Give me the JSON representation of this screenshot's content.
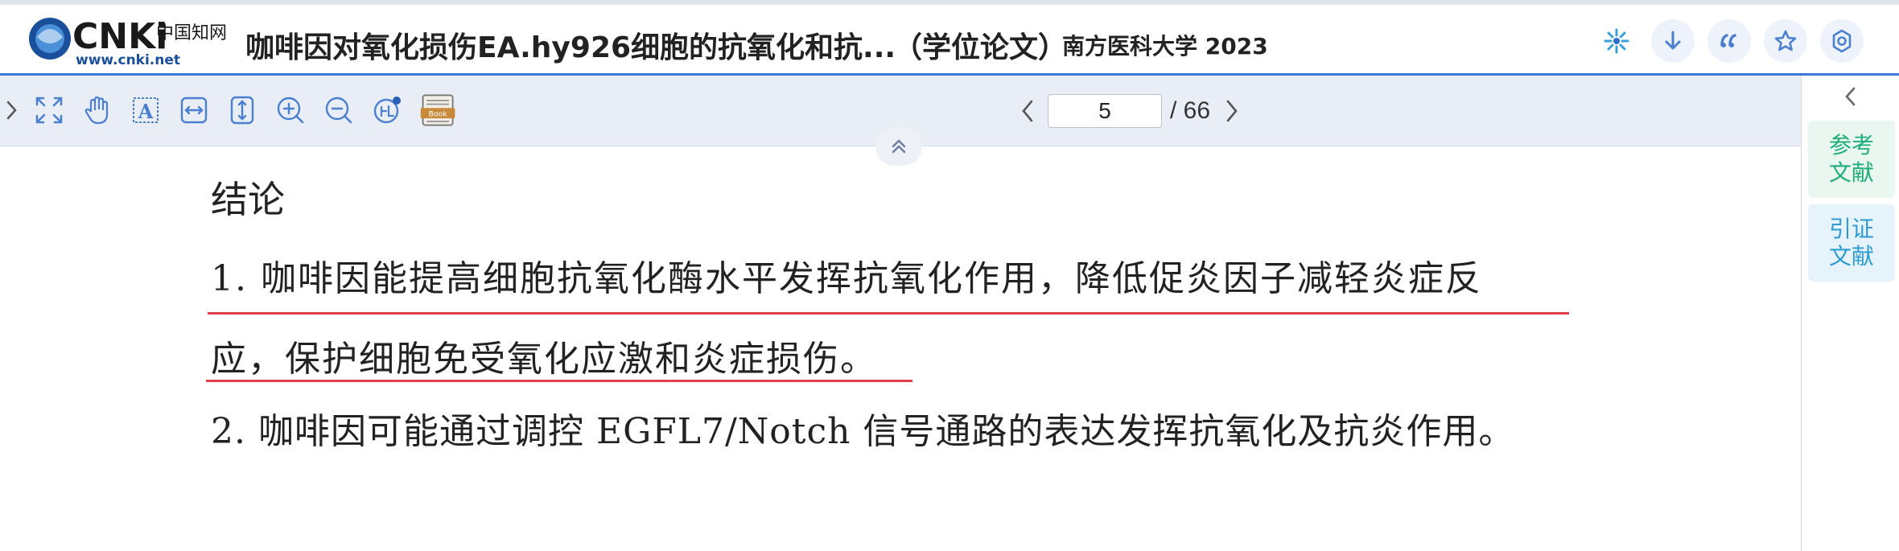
{
  "header": {
    "logo_main": "CNKi",
    "logo_cn": "中国知网",
    "logo_url": "www.cnki.net",
    "doc_title": "咖啡因对氧化损伤EA.hy926细胞的抗氧化和抗...",
    "doc_type": "（学位论文）",
    "doc_source": "南方医科大学 2023",
    "buttons": [
      {
        "name": "ai-assistant-icon"
      },
      {
        "name": "download-icon"
      },
      {
        "name": "quote-icon"
      },
      {
        "name": "favorite-star-icon"
      },
      {
        "name": "settings-gear-icon"
      }
    ]
  },
  "toolbar": {
    "tools": [
      "expand",
      "expand-fullscreen",
      "hand-pan",
      "text-select",
      "fit-width",
      "fit-height",
      "zoom-in",
      "zoom-out",
      "ocr",
      "book-view"
    ],
    "book_label": "Book",
    "page_current": "5",
    "page_total": "/ 66"
  },
  "side_panel": {
    "ref_label": "参考文献",
    "cite_label": "引证文献"
  },
  "content": {
    "heading": "结论",
    "line1": "1.  咖啡因能提高细胞抗氧化酶水平发挥抗氧化作用，降低促炎因子减轻炎症反",
    "line2": "应，保护细胞免受氧化应激和炎症损伤。",
    "line3": "2.  咖啡因可能通过调控 EGFL7/Notch 信号通路的表达发挥抗氧化及抗炎作用。"
  },
  "colors": {
    "accent": "#3d78d8",
    "icon": "#4b7fcf",
    "highlight_underline": "#e0404a",
    "ref_green": "#1fae7a",
    "cite_blue": "#2f9bd1"
  }
}
